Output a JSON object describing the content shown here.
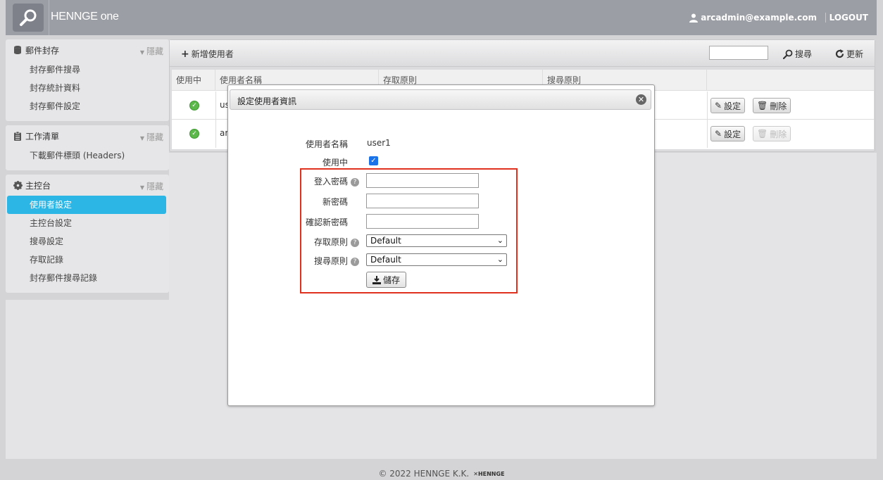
{
  "header": {
    "brand": "HENNGE one",
    "user": "arcadmin@example.com",
    "logout": "LOGOUT"
  },
  "sidebar": {
    "sections": [
      {
        "title": "郵件封存",
        "hide": "隱藏",
        "items": [
          "封存郵件搜尋",
          "封存統計資料",
          "封存郵件設定"
        ]
      },
      {
        "title": "工作清單",
        "hide": "隱藏",
        "items": [
          "下載郵件標頭 (Headers)"
        ]
      },
      {
        "title": "主控台",
        "hide": "隱藏",
        "items": [
          "使用者設定",
          "主控台設定",
          "搜尋設定",
          "存取記錄",
          "封存郵件搜尋記錄"
        ]
      }
    ]
  },
  "toolbar": {
    "add_user": "新增使用者",
    "search": "搜尋",
    "refresh": "更新"
  },
  "table": {
    "headers": [
      "使用中",
      "使用者名稱",
      "存取原則",
      "搜尋原則",
      ""
    ],
    "rows": [
      {
        "name": "us",
        "edit": "設定",
        "delete": "刪除"
      },
      {
        "name": "ar",
        "edit": "設定",
        "delete": "刪除"
      }
    ]
  },
  "modal": {
    "title": "設定使用者資訊",
    "username_label": "使用者名稱",
    "username_value": "user1",
    "active_label": "使用中",
    "login_password_label": "登入密碼",
    "new_password_label": "新密碼",
    "confirm_password_label": "確認新密碼",
    "access_policy_label": "存取原則",
    "access_policy_value": "Default",
    "search_policy_label": "搜尋原則",
    "search_policy_value": "Default",
    "save": "儲存"
  },
  "footer": {
    "copyright": "© 2022 HENNGE K.K.",
    "mini_logo": "HENNGE"
  },
  "colors": {
    "accent": "#2bb6e6",
    "highlight": "#e0301e",
    "ok": "#5cb84a"
  }
}
